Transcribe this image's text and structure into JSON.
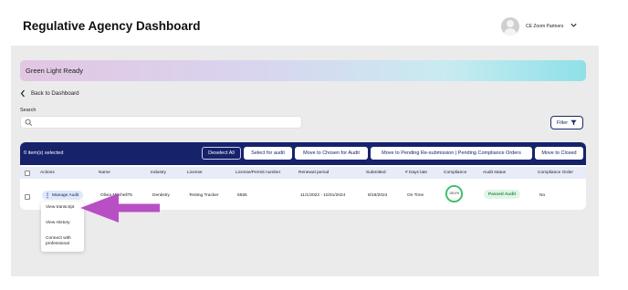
{
  "header": {
    "title": "Regulative Agency Dashboard",
    "org_name": "CE Zoom Partners",
    "avatar_icon": "user-avatar-icon",
    "menu_icon": "chevron-down-icon"
  },
  "banner": {
    "text": "Green Light Ready"
  },
  "nav": {
    "back_label": "Back to Dashboard"
  },
  "search": {
    "label": "Search",
    "placeholder": "",
    "value": ""
  },
  "filter": {
    "label": "Filter"
  },
  "toolbar": {
    "selection_count": "0 item(s) selected",
    "buttons": [
      "Deselect All",
      "Select for audit",
      "Move to Chosen for Audit",
      "Move to Pending Re-submission | Pending Compliance Orders",
      "Move to Closed"
    ]
  },
  "table": {
    "columns": [
      "Actions",
      "Name",
      "Industry",
      "License",
      "License/Permit number",
      "Renewal period",
      "Submitted",
      "# Days late",
      "Compliance",
      "Audit status",
      "Compliance Order"
    ],
    "rows": [
      {
        "action": "Manage Audit",
        "name": "Olivia Mitchell75",
        "industry": "Dentistry",
        "license": "Testing Tracker",
        "permit_number": "5555",
        "renewal_period": "11/1/2022 - 10/31/2024",
        "submitted": "8/19/2024",
        "days_late": "On Time",
        "compliance": "100.0%",
        "compliance_fraction": 1.0,
        "audit_status": "Passed Audit",
        "compliance_order": "No"
      }
    ]
  },
  "dropdown": {
    "items": [
      "View transcript",
      "View History",
      "Connect with",
      "professional"
    ]
  },
  "colors": {
    "navy": "#16226a",
    "pass_green": "#2e8b4a",
    "ring_green": "#3bbf6a",
    "annotation_arrow": "#b84fc4"
  }
}
